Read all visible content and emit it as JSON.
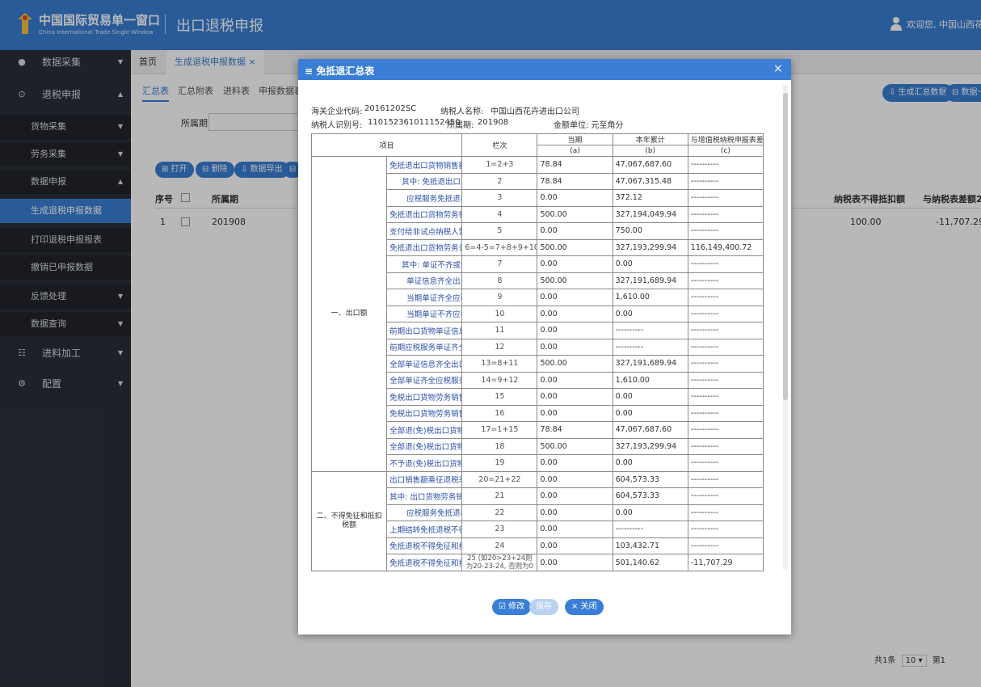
{
  "header": {
    "logo_cn": "中国国际贸易单一窗口",
    "logo_en": "China International Trade Single Window",
    "title": "出口退税申报",
    "user_text": "欢迎您, 中国山西花"
  },
  "sidebar": {
    "items": [
      {
        "icon": "●",
        "label": "数据采集",
        "arrow": "▼"
      },
      {
        "icon": "⊙",
        "label": "退税申报",
        "arrow": "▲"
      },
      {
        "label": "货物采集",
        "arrow": "▼"
      },
      {
        "label": "劳务采集",
        "arrow": "▼"
      },
      {
        "label": "数据申报",
        "arrow": "▲"
      },
      {
        "label": "生成退税申报数据"
      },
      {
        "label": "打印退税申报报表"
      },
      {
        "label": "撤销已申报数据"
      },
      {
        "label": "反馈处理",
        "arrow": "▼"
      },
      {
        "label": "数据查询",
        "arrow": "▼"
      },
      {
        "icon": "☷",
        "label": "进料加工",
        "arrow": "▼"
      },
      {
        "icon": "⚙",
        "label": "配置",
        "arrow": "▼"
      }
    ]
  },
  "tabs": {
    "home": "首页",
    "current": "生成退税申报数据 ×"
  },
  "main": {
    "subtabs": [
      "汇总表",
      "汇总附表",
      "进料表",
      "申报数据表"
    ],
    "field_label": "所属期",
    "buttons": [
      "⊞ 打开",
      "⊟ 删除",
      "⇩ 数据导出",
      "⊟"
    ],
    "top_buttons": [
      "⇩ 生成汇总数据",
      "⊟ 数据一"
    ],
    "table_header": {
      "seq": "序号",
      "period": "所属期",
      "col_a": "纳税表不得抵扣额",
      "col_b": "与纳税表差额2"
    },
    "row": {
      "seq": "1",
      "period": "201908",
      "col_a": "100.00",
      "col_b": "-11,707.29"
    },
    "pager": {
      "total": "共1条",
      "size": "10",
      "page": "第1"
    }
  },
  "modal": {
    "title": "≡ 免抵退汇总表",
    "close": "×",
    "customs_code_label": "海关企业代码:",
    "customs_code": "20161202SC",
    "taxpayer_name_label": "纳税人名称:",
    "taxpayer_name": "中国山西花卉进出口公司",
    "taxpayer_id_label": "纳税人识别号:",
    "taxpayer_id": "110152361011152450",
    "period_label": "所属期:",
    "period": "201908",
    "unit": "金额单位: 元至角分",
    "columns": {
      "item": "项目",
      "line": "栏次",
      "current": "当期",
      "current_sub": "(a)",
      "ytd": "本年累计",
      "ytd_sub": "(b)",
      "diff": "与增值税纳税申报表差",
      "diff_sub": "(c)"
    },
    "section1": "一、出口额",
    "section2": "二、不得免征和抵扣税额",
    "rows": [
      {
        "name": "免抵退出口货物销售额(美元)",
        "code": "1=2+3",
        "a": "78.84",
        "b": "47,067,687.60",
        "c": "----------"
      },
      {
        "name": "其中: 免抵退出口货物销售额(美元)",
        "code": "2",
        "a": "78.84",
        "b": "47,067,315.48",
        "c": "----------"
      },
      {
        "name": "应税服务免抵退税营业额(美元)",
        "code": "3",
        "a": "0.00",
        "b": "372.12",
        "c": "----------"
      },
      {
        "name": "免抵退出口货物劳务销售额",
        "code": "4",
        "a": "500.00",
        "b": "327,194,049.94",
        "c": "----------"
      },
      {
        "name": "支付给非试点纳税人营业价款",
        "code": "5",
        "a": "0.00",
        "b": "750.00",
        "c": "----------"
      },
      {
        "name": "免抵退出口货物劳务计税金额",
        "code": "6=4-5=7+8+9+10",
        "a": "500.00",
        "b": "327,193,299.94",
        "c": "116,149,400.72"
      },
      {
        "name": "其中: 单证不齐或信息不齐出口货物销售额",
        "code": "7",
        "a": "0.00",
        "b": "0.00",
        "c": "----------"
      },
      {
        "name": "单证信息齐全出口货物销售额",
        "code": "8",
        "a": "500.00",
        "b": "327,191,689.94",
        "c": "----------"
      },
      {
        "name": "当期单证齐全应税服务免抵退税计税金额",
        "code": "9",
        "a": "0.00",
        "b": "1,610.00",
        "c": "----------"
      },
      {
        "name": "当期单证不齐应税服务免抵退税计税金额",
        "code": "10",
        "a": "0.00",
        "b": "0.00",
        "c": "----------"
      },
      {
        "name": "前期出口货物单证信息齐全销售额",
        "code": "11",
        "a": "0.00",
        "b": "----------",
        "c": "----------"
      },
      {
        "name": "前期应税服务单证齐全免抵退税计税金额",
        "code": "12",
        "a": "0.00",
        "b": "----------",
        "c": "----------"
      },
      {
        "name": "全部单证信息齐全出口货物销售额",
        "code": "13=8+11",
        "a": "500.00",
        "b": "327,191,689.94",
        "c": "----------"
      },
      {
        "name": "全部单证齐全应税服务免抵退税计税金额",
        "code": "14=9+12",
        "a": "0.00",
        "b": "1,610.00",
        "c": "----------"
      },
      {
        "name": "免税出口货物劳务销售额(美元)",
        "code": "15",
        "a": "0.00",
        "b": "0.00",
        "c": "----------"
      },
      {
        "name": "免税出口货物劳务销售额",
        "code": "16",
        "a": "0.00",
        "b": "0.00",
        "c": "----------"
      },
      {
        "name": "全部退(免)税出口货物劳务销售额(美元)",
        "code": "17=1+15",
        "a": "78.84",
        "b": "47,067,687.60",
        "c": "----------"
      },
      {
        "name": "全部退(免)税出口货物劳务销售额",
        "code": "18",
        "a": "500.00",
        "b": "327,193,299.94",
        "c": "----------"
      },
      {
        "name": "不予退(免)税出口货物劳务销售额",
        "code": "19",
        "a": "0.00",
        "b": "0.00",
        "c": "----------"
      },
      {
        "name": "出口销售额乘征退税率之差",
        "code": "20=21+22",
        "a": "0.00",
        "b": "604,573.33",
        "c": "----------"
      },
      {
        "name": "其中: 出口货物劳务销售额乘征退税率之差",
        "code": "21",
        "a": "0.00",
        "b": "604,573.33",
        "c": "----------"
      },
      {
        "name": "应税服务免抵退税计税金额乘征退税率之差",
        "code": "22",
        "a": "0.00",
        "b": "0.00",
        "c": "----------"
      },
      {
        "name": "上期结转免抵退税不得免征和抵扣税额抵减额",
        "code": "23",
        "a": "0.00",
        "b": "----------",
        "c": "----------"
      },
      {
        "name": "免抵退税不得免征和抵扣税额抵减额",
        "code": "24",
        "a": "0.00",
        "b": "103,432.71",
        "c": "----------"
      },
      {
        "name": "免抵退税不得免征和抵扣税额",
        "code": "25 (如20>23+24则为20-23-24, 否则为0",
        "a": "0.00",
        "b": "501,140.62",
        "c": "-11,707.29"
      }
    ],
    "footer_buttons": {
      "modify": "☑ 修改",
      "save": "保存",
      "close": "× 关闭"
    }
  }
}
